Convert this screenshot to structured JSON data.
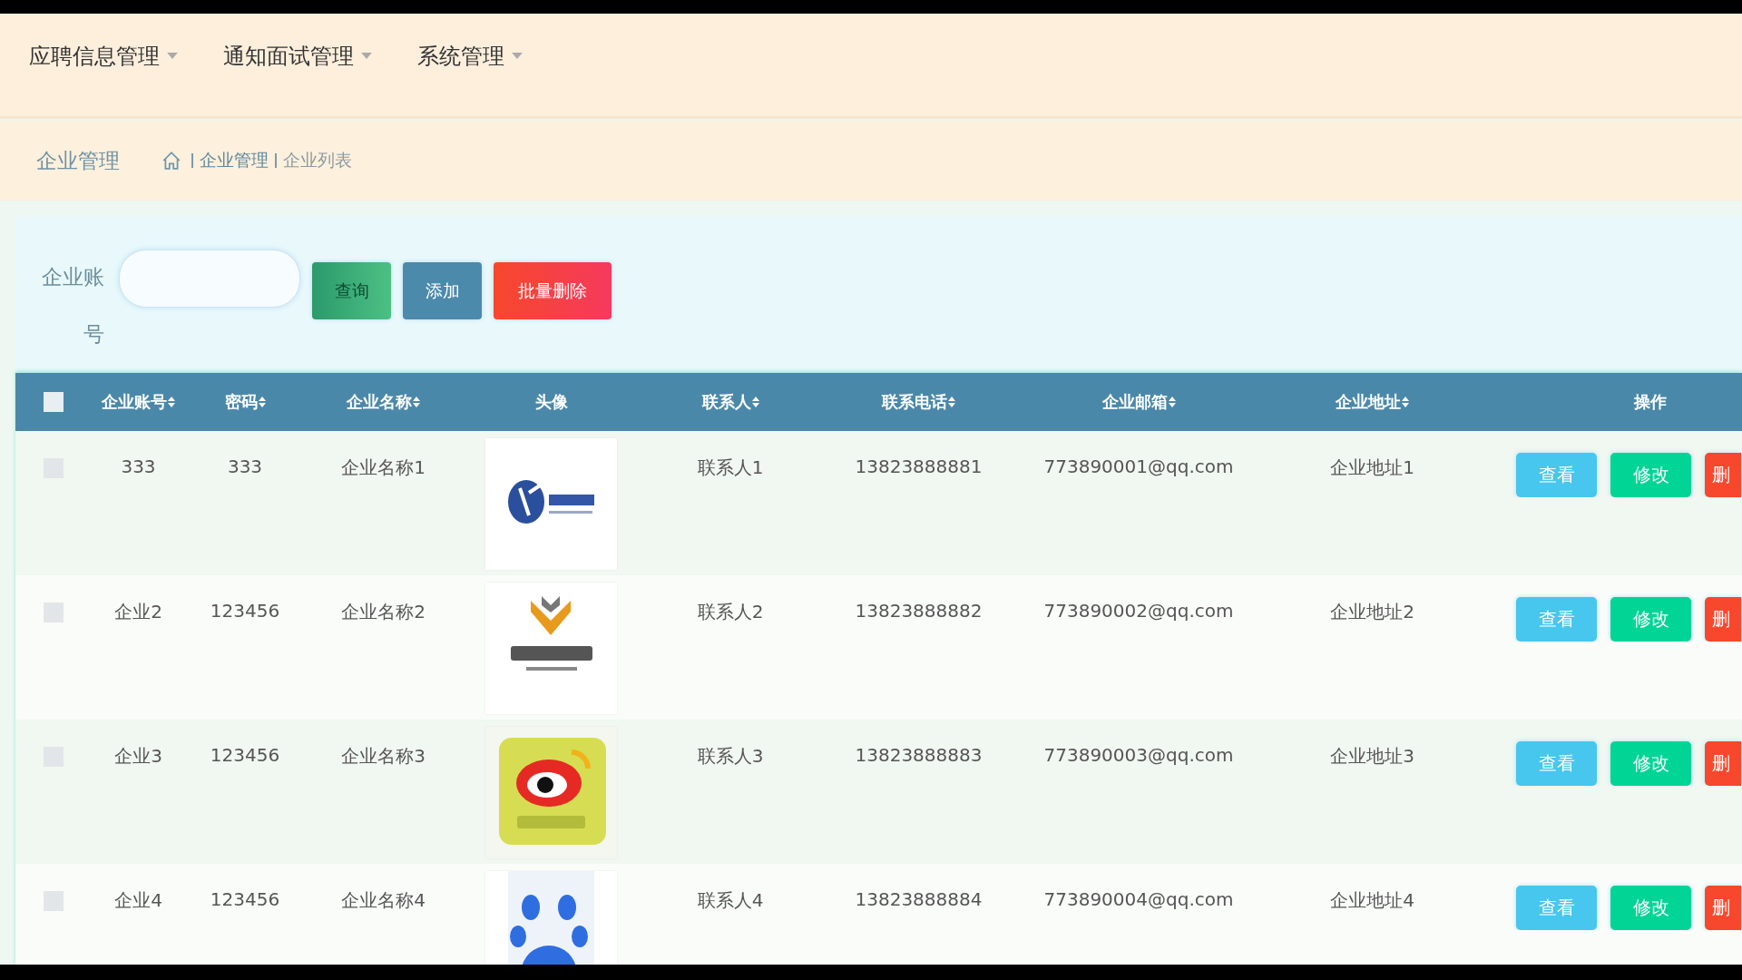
{
  "nav": [
    {
      "label": "应聘信息管理"
    },
    {
      "label": "通知面试管理"
    },
    {
      "label": "系统管理"
    }
  ],
  "page_title": "企业管理",
  "breadcrumb": [
    "企业管理",
    "企业列表"
  ],
  "search": {
    "label": "企业账号"
  },
  "buttons": [
    {
      "label": "查询",
      "kind": "search"
    },
    {
      "label": "添加",
      "kind": "add"
    },
    {
      "label": "批量删除",
      "kind": "delete"
    }
  ],
  "table": {
    "all_checked": false,
    "columns": [
      {
        "label": "企业账号",
        "sortable": true
      },
      {
        "label": "密码",
        "sortable": true
      },
      {
        "label": "企业名称",
        "sortable": true
      },
      {
        "label": "头像",
        "sortable": false
      },
      {
        "label": "联系人",
        "sortable": true
      },
      {
        "label": "联系电话",
        "sortable": true
      },
      {
        "label": "企业邮箱",
        "sortable": true
      },
      {
        "label": "企业地址",
        "sortable": true
      },
      {
        "label": "操作",
        "sortable": false
      }
    ],
    "rows": [
      {
        "checked": false,
        "avatar": {
          "kind": "picture"
        },
        "cells": [
          "333",
          "333",
          "企业名称1",
          "",
          "联系人1",
          "13823888881",
          "773890001@qq.com",
          "企业地址1"
        ],
        "actions": [
          {
            "label": "查看",
            "kind": "view"
          },
          {
            "label": "修改",
            "kind": "edit"
          },
          {
            "label": "删",
            "kind": "delete"
          }
        ]
      },
      {
        "checked": false,
        "avatar": {
          "kind": "picture"
        },
        "cells": [
          "企业2",
          "123456",
          "企业名称2",
          "",
          "联系人2",
          "13823888882",
          "773890002@qq.com",
          "企业地址2"
        ],
        "actions": [
          {
            "label": "查看",
            "kind": "view"
          },
          {
            "label": "修改",
            "kind": "edit"
          },
          {
            "label": "删",
            "kind": "delete"
          }
        ]
      },
      {
        "checked": false,
        "avatar": {
          "kind": "picture"
        },
        "cells": [
          "企业3",
          "123456",
          "企业名称3",
          "",
          "联系人3",
          "13823888883",
          "773890003@qq.com",
          "企业地址3"
        ],
        "actions": [
          {
            "label": "查看",
            "kind": "view"
          },
          {
            "label": "修改",
            "kind": "edit"
          },
          {
            "label": "删",
            "kind": "delete"
          }
        ]
      },
      {
        "checked": false,
        "avatar": {
          "kind": "picture"
        },
        "cells": [
          "企业4",
          "123456",
          "企业名称4",
          "",
          "联系人4",
          "13823888884",
          "773890004@qq.com",
          "企业地址4"
        ],
        "actions": [
          {
            "label": "查看",
            "kind": "view"
          },
          {
            "label": "修改",
            "kind": "edit"
          },
          {
            "label": "删",
            "kind": "delete"
          }
        ]
      }
    ]
  }
}
